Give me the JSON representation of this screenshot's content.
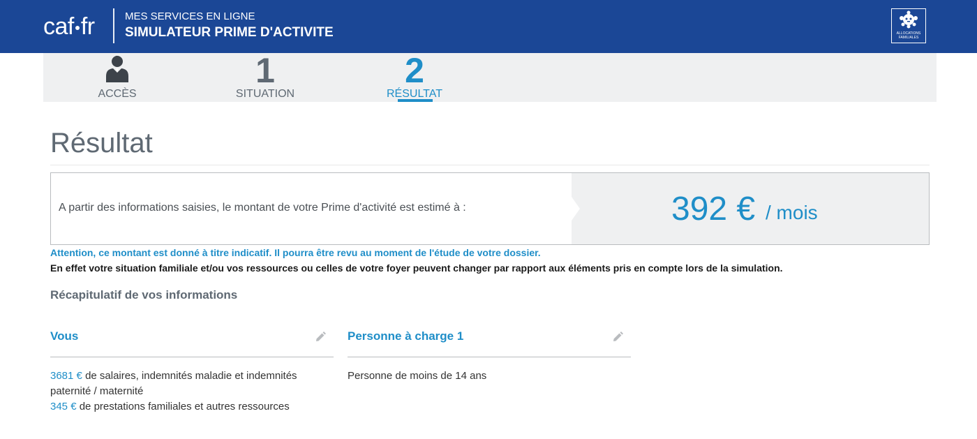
{
  "header": {
    "logo_left": "caf",
    "logo_right": "fr",
    "subtitle": "MES SERVICES EN LIGNE",
    "title": "SIMULATEUR PRIME D'ACTIVITE",
    "emblem_text": "ALLOCATIONS FAMILIALES"
  },
  "steps": [
    {
      "icon": "user-icon",
      "label": "ACCÈS",
      "state": "done"
    },
    {
      "number": "1",
      "label": "SITUATION",
      "state": "done"
    },
    {
      "number": "2",
      "label": "RÉSULTAT",
      "state": "active"
    }
  ],
  "page_title": "Résultat",
  "result": {
    "text": "A partir des informations saisies, le montant de votre Prime d'activité est estimé à :",
    "amount": "392 €",
    "unit": "/ mois"
  },
  "notices": {
    "warning": "Attention, ce montant est donné à titre indicatif. Il pourra être revu au moment de l'étude de votre dossier.",
    "info": "En effet votre situation familiale et/ou vos ressources ou celles de votre foyer peuvent changer par rapport aux éléments pris en compte lors de la simulation."
  },
  "recap_title": "Récapitulatif de vos informations",
  "cards": {
    "vous": {
      "title": "Vous",
      "line1_amount": "3681 €",
      "line1_text": "de salaires, indemnités maladie et indemnités paternité / maternité",
      "line2_amount": "345 €",
      "line2_text": "de prestations familiales et autres ressources"
    },
    "charge": {
      "title": "Personne à charge 1",
      "text": "Personne de moins de 14 ans"
    }
  },
  "colors": {
    "header_bg": "#1b4796",
    "accent": "#1f8ec8",
    "step_bg": "#eff0f1",
    "muted": "#5f6973"
  }
}
